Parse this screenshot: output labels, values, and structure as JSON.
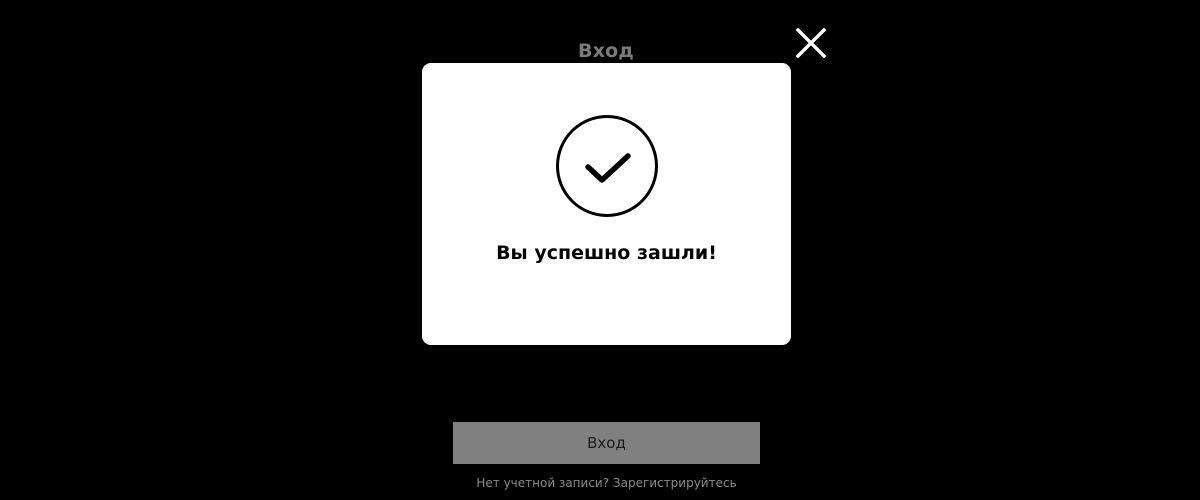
{
  "login": {
    "title": "Вход",
    "submit_label": "Вход",
    "register_prompt": "Нет учетной записи?",
    "register_link": "Зарегистрируйтесь"
  },
  "close": {
    "icon": "close-icon"
  },
  "modal": {
    "icon": "checkmark-circle-icon",
    "message": "Вы успешно зашли!"
  },
  "colors": {
    "background": "#000000",
    "modal_background": "#ffffff",
    "dimmed_text": "#7a7a7a",
    "dimmed_button": "#808080"
  }
}
